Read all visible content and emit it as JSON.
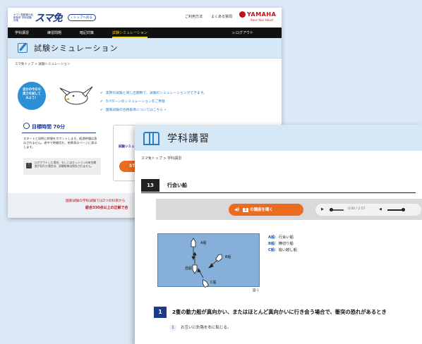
{
  "screen_a": {
    "logo_sub": "ヤマハ発動機の船舶免許 学科試験対策",
    "logo": "スマ免",
    "top_link": "トップへ戻る",
    "header_links": [
      "ご利用方法",
      "よくある質問"
    ],
    "brand": {
      "word": "YAMAHA",
      "tag": "Revs Your Heart"
    },
    "nav": [
      "学科講習",
      "練習問題",
      "暗記対策",
      "試験シミュレーション"
    ],
    "nav_active": "試験シミュレーション",
    "logout": "ログアウト",
    "page_title": "試験シミュレーション",
    "breadcrumb": "スマ免トップ > 試験シミュレーション",
    "bubble": [
      "自分の今日の",
      "実力を試して",
      "みよう！"
    ],
    "checks": [
      "実際の試験と同じ出題数で、試験のシミュレーションができます。",
      "3パターンのシミュレーションをご用意",
      "国家試験の合格基準についてはこちら »"
    ],
    "timer": "目標時間 70分",
    "desc": "スタートと同時に時間をカウントします。経過時間は表示されません。途中で時間切れ、結果表示ページに表示します。",
    "warning": "ログアウトした場合、もしくはセッションの有効期限が切れた場合は、試験結果は保存されません。",
    "card_label": "試験シミュレ",
    "card_num": "1",
    "start": "STA",
    "footer_note": "国家試験の学科試験では3つの科目から",
    "footer_pass": "総合330点以上の正解で合"
  },
  "screen_b": {
    "title": "学科講習",
    "breadcrumb": "スマ免トップ > 学科講習",
    "section_num": "13",
    "section_title": "行会い船",
    "audio_button_num": "1",
    "audio_button": "の講座を聞く",
    "player_time": "0:00 / 2:57",
    "figure_labels": {
      "a": "A船",
      "b": "B船",
      "c": "C船",
      "self": "自船"
    },
    "legend": [
      {
        "key": "A船",
        "text": "：行会い船"
      },
      {
        "key": "B船",
        "text": "：横切り船"
      },
      {
        "key": "C船",
        "text": "：追い越し船"
      }
    ],
    "figure_caption": "図-1",
    "question_num": "1",
    "question": "2隻の動力船が真向かい、またはほとんど真向かいに行き会う場合で、衝突の恐れがあるとき",
    "answer_num": "1",
    "answer": "お互いに針路を右に転じる。"
  }
}
